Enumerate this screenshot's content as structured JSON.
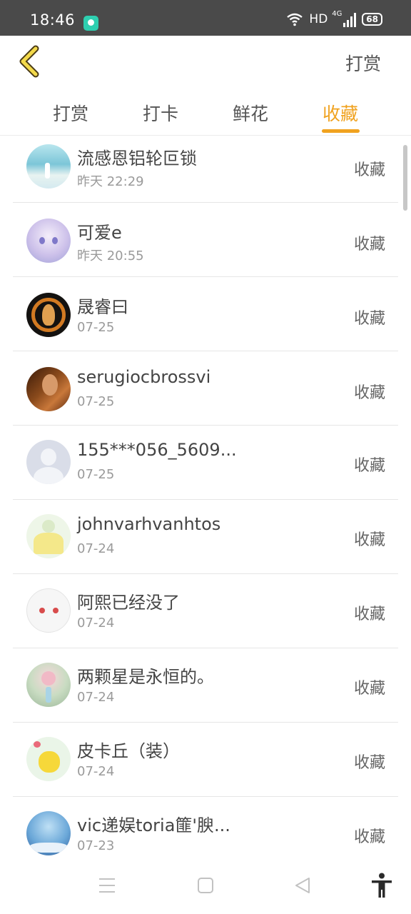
{
  "status_bar": {
    "time": "18:46",
    "network": "HD",
    "signal": "4G",
    "battery": "68"
  },
  "header": {
    "action_label": "打赏"
  },
  "tabs": [
    {
      "label": "打赏",
      "active": false
    },
    {
      "label": "打卡",
      "active": false
    },
    {
      "label": "鲜花",
      "active": false
    },
    {
      "label": "收藏",
      "active": true
    }
  ],
  "accent_color": "#f0a21f",
  "rows": [
    {
      "name": "流感恩铝轮叵锁",
      "time": "昨天 22:29",
      "action": "收藏"
    },
    {
      "name": "可爱e",
      "time": "昨天 20:55",
      "action": "收藏"
    },
    {
      "name": "晟睿曰",
      "time": "07-25",
      "action": "收藏"
    },
    {
      "name": "serugiocbrossvi",
      "time": "07-25",
      "action": "收藏"
    },
    {
      "name": "155***056_5609...",
      "time": "07-25",
      "action": "收藏"
    },
    {
      "name": "johnvarhvanhtos",
      "time": "07-24",
      "action": "收藏"
    },
    {
      "name": "阿熙已经没了",
      "time": "07-24",
      "action": "收藏"
    },
    {
      "name": "两颗星是永恒的。",
      "time": "07-24",
      "action": "收藏"
    },
    {
      "name": "皮卡丘（装）",
      "time": "07-24",
      "action": "收藏"
    },
    {
      "name": "vic递娱toria篚'腴...",
      "time": "07-23",
      "action": "收藏"
    }
  ]
}
